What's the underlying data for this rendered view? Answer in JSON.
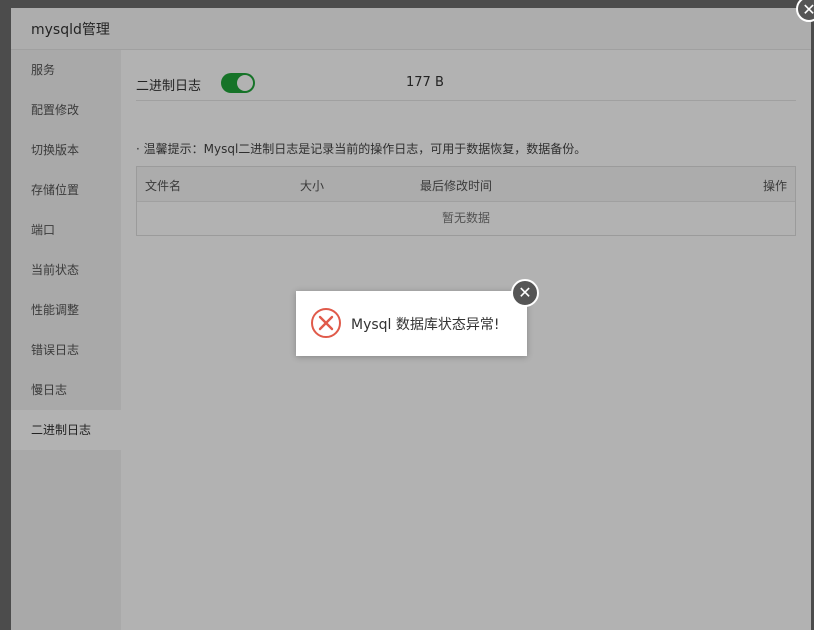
{
  "window": {
    "title": "mysqld管理"
  },
  "sidebar": {
    "items": [
      {
        "label": "服务"
      },
      {
        "label": "配置修改"
      },
      {
        "label": "切换版本"
      },
      {
        "label": "存储位置"
      },
      {
        "label": "端口"
      },
      {
        "label": "当前状态"
      },
      {
        "label": "性能调整"
      },
      {
        "label": "错误日志"
      },
      {
        "label": "慢日志"
      },
      {
        "label": "二进制日志"
      }
    ],
    "active_index": 9
  },
  "main": {
    "binlog_label": "二进制日志",
    "binlog_enabled": true,
    "binlog_size": "177 B",
    "tip": "· 温馨提示：Mysql二进制日志是记录当前的操作日志，可用于数据恢复，数据备份。",
    "table": {
      "headers": [
        "文件名",
        "大小",
        "最后修改时间",
        "操作"
      ],
      "empty_text": "暂无数据"
    }
  },
  "dialog": {
    "message": "Mysql 数据库状态异常!",
    "icon": "error-x-circle-icon"
  },
  "colors": {
    "accent_green": "#20a53a",
    "error_red": "#e05a4a"
  }
}
